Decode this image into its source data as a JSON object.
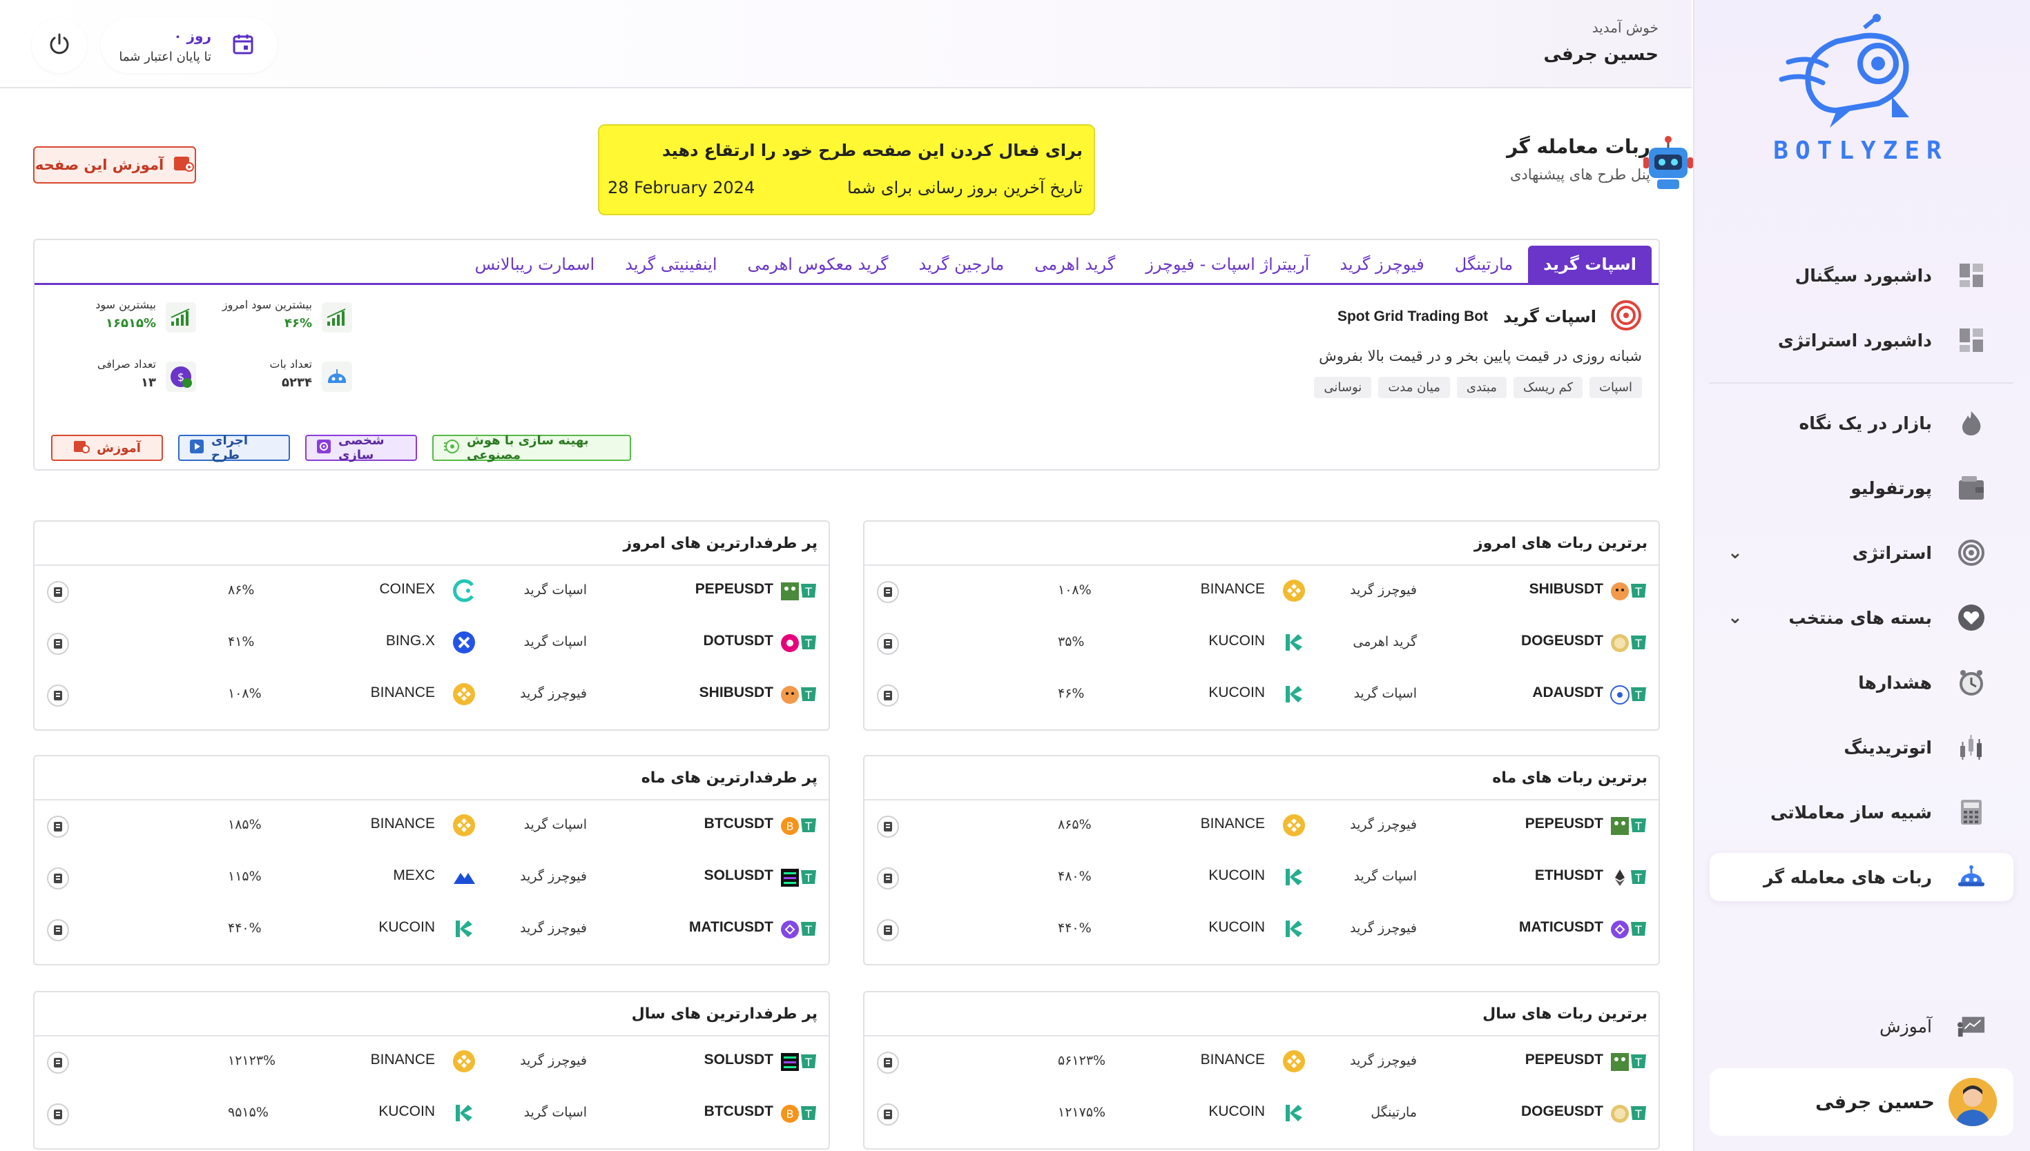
{
  "brand": {
    "name": "BOTLYZER",
    "accent": "#3a7bf2"
  },
  "topbar": {
    "welcome": "خوش آمدید",
    "user_name": "حسین جرفی",
    "credit_days": "۰ روز",
    "credit_caption": "تا پایان اعتبار شما",
    "power_icon": "power-icon",
    "calendar_icon": "calendar-icon"
  },
  "sidebar": {
    "items": [
      {
        "label": "داشبورد سیگنال",
        "icon": "dashboard-icon"
      },
      {
        "label": "داشبورد استراتژی",
        "icon": "dashboard-icon"
      },
      {
        "label": "بازار در یک نگاه",
        "icon": "fire-icon"
      },
      {
        "label": "پورتفولیو",
        "icon": "wallet-icon"
      },
      {
        "label": "استراتژی",
        "icon": "target-icon"
      },
      {
        "label": "بسته های منتخب",
        "icon": "heart-icon"
      },
      {
        "label": "هشدارها",
        "icon": "alarm-clock-icon"
      },
      {
        "label": "اتوتریدینگ",
        "icon": "candles-icon"
      },
      {
        "label": "شبیه ساز معاملاتی",
        "icon": "calculator-icon"
      },
      {
        "label": "ربات های معامله گر",
        "icon": "robot-icon"
      }
    ],
    "education": "آموزش",
    "user_name": "حسین جرفی"
  },
  "page": {
    "title": "ربات معامله گر",
    "subtitle": "پنل طرح های پیشنهادی",
    "tutorial_button": "آموزش این صفحه"
  },
  "notice": {
    "line1": "برای فعال کردن این صفحه طرح خود را ارتقاع دهید",
    "line2": "تاریخ آخرین بروز رسانی برای شما",
    "date": "28 February 2024",
    "bg": "#fff832"
  },
  "tabs": [
    "اسپات گرید",
    "مارتینگل",
    "فیوچرز گرید",
    "آربیتراژ اسپات - فیوچرز",
    "گرید اهرمی",
    "مارجین گرید",
    "گرید معکوس اهرمی",
    "اینفینیتی گرید",
    "اسمارت ریبالانس"
  ],
  "bot": {
    "title": "اسپات گرید",
    "name_en": "Spot Grid Trading Bot",
    "description": "شبانه روزی در قیمت پایین بخر و در قیمت بالا بفروش",
    "tags": [
      "اسپات",
      "کم ریسک",
      "مبتدی",
      "میان مدت",
      "نوسانی"
    ],
    "stats": {
      "today_profit_label": "بیشترین سود امروز",
      "today_profit": "۴۶%",
      "max_profit_label": "بیشترین سود",
      "max_profit": "۱۶۵۱۵%",
      "bots_label": "تعداد بات",
      "bots": "۵۲۳۴",
      "exchanges_label": "تعداد صرافی",
      "exchanges": "۱۳"
    },
    "actions": {
      "ai": "بهینه سازی با هوش مصنوعی",
      "customize": "شخصی سازی",
      "run": "اجرای طرح",
      "learn": "آموزش"
    }
  },
  "cards": [
    {
      "title": "برترین ربات های امروز",
      "rows": [
        {
          "symbol": "SHIBUSDT",
          "strategy": "فیوچرز گرید",
          "exchange": "BINANCE",
          "pct": "۱۰۸%",
          "coin": "shib"
        },
        {
          "symbol": "DOGEUSDT",
          "strategy": "گرید اهرمی",
          "exchange": "KUCOIN",
          "pct": "۳۵%",
          "coin": "doge"
        },
        {
          "symbol": "ADAUSDT",
          "strategy": "اسپات گرید",
          "exchange": "KUCOIN",
          "pct": "۴۶%",
          "coin": "ada"
        }
      ]
    },
    {
      "title": "پر طرفدارترین های امروز",
      "rows": [
        {
          "symbol": "PEPEUSDT",
          "strategy": "اسپات گرید",
          "exchange": "COINEX",
          "pct": "۸۶%",
          "coin": "pepe"
        },
        {
          "symbol": "DOTUSDT",
          "strategy": "اسپات گرید",
          "exchange": "BING.X",
          "pct": "۴۱%",
          "coin": "dot"
        },
        {
          "symbol": "SHIBUSDT",
          "strategy": "فیوچرز گرید",
          "exchange": "BINANCE",
          "pct": "۱۰۸%",
          "coin": "shib"
        }
      ]
    },
    {
      "title": "برترین ربات های ماه",
      "rows": [
        {
          "symbol": "PEPEUSDT",
          "strategy": "فیوچرز گرید",
          "exchange": "BINANCE",
          "pct": "۸۶۵%",
          "coin": "pepe"
        },
        {
          "symbol": "ETHUSDT",
          "strategy": "اسپات گرید",
          "exchange": "KUCOIN",
          "pct": "۴۸۰%",
          "coin": "eth"
        },
        {
          "symbol": "MATICUSDT",
          "strategy": "فیوچرز گرید",
          "exchange": "KUCOIN",
          "pct": "۴۴۰%",
          "coin": "matic"
        }
      ]
    },
    {
      "title": "پر طرفدارترین های ماه",
      "rows": [
        {
          "symbol": "BTCUSDT",
          "strategy": "اسپات گرید",
          "exchange": "BINANCE",
          "pct": "۱۸۵%",
          "coin": "btc"
        },
        {
          "symbol": "SOLUSDT",
          "strategy": "فیوچرز گرید",
          "exchange": "MEXC",
          "pct": "۱۱۵%",
          "coin": "sol"
        },
        {
          "symbol": "MATICUSDT",
          "strategy": "فیوچرز گرید",
          "exchange": "KUCOIN",
          "pct": "۴۴۰%",
          "coin": "matic"
        }
      ]
    },
    {
      "title": "برترین ربات های سال",
      "rows": [
        {
          "symbol": "PEPEUSDT",
          "strategy": "فیوچرز گرید",
          "exchange": "BINANCE",
          "pct": "۵۶۱۲۳%",
          "coin": "pepe"
        },
        {
          "symbol": "DOGEUSDT",
          "strategy": "مارتینگل",
          "exchange": "KUCOIN",
          "pct": "۱۲۱۷۵%",
          "coin": "doge"
        }
      ]
    },
    {
      "title": "پر طرفدارترین های سال",
      "rows": [
        {
          "symbol": "SOLUSDT",
          "strategy": "فیوچرز گرید",
          "exchange": "BINANCE",
          "pct": "۱۲۱۲۳%",
          "coin": "sol"
        },
        {
          "symbol": "BTCUSDT",
          "strategy": "اسپات گرید",
          "exchange": "KUCOIN",
          "pct": "۹۵۱۵%",
          "coin": "btc"
        }
      ]
    }
  ]
}
